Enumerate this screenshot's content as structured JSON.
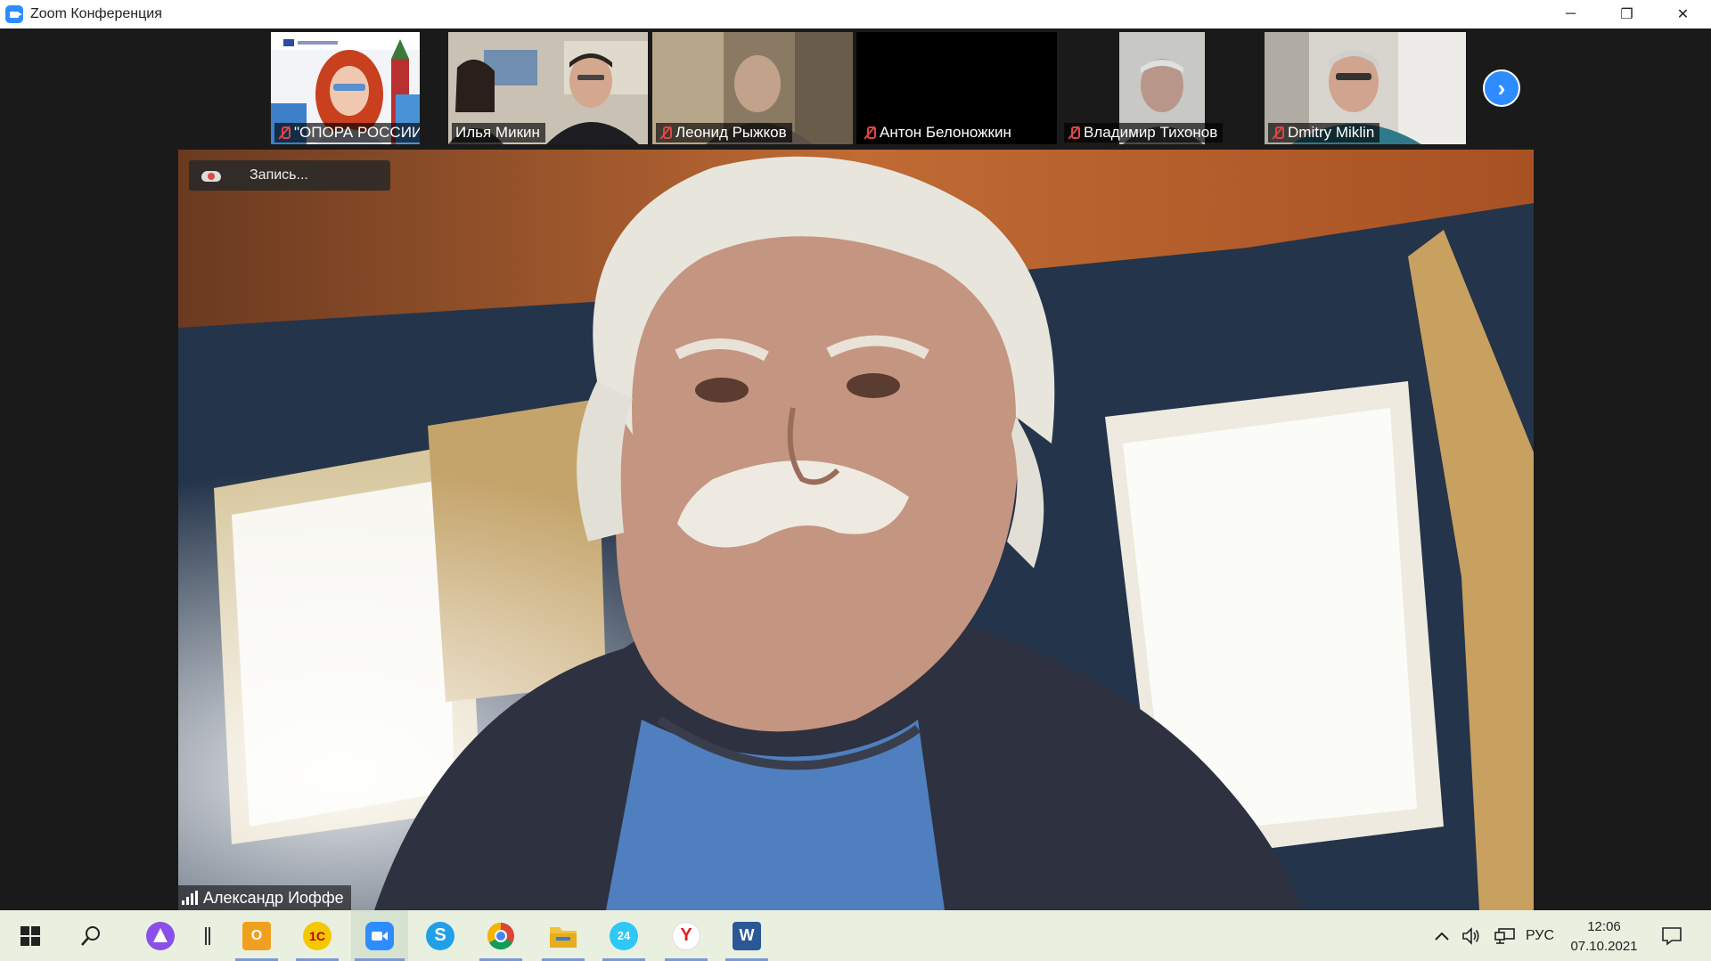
{
  "window": {
    "title": "Zoom Конференция",
    "minimize": "─",
    "restore": "❐",
    "close": "✕"
  },
  "participants": [
    {
      "name": "\"ОПОРА РОССИИ\"",
      "muted": true
    },
    {
      "name": "Илья Микин",
      "muted": false
    },
    {
      "name": "Леонид Рыжков",
      "muted": true
    },
    {
      "name": "Антон Белоножкин",
      "muted": true
    },
    {
      "name": "Владимир Тихонов",
      "muted": true
    },
    {
      "name": "Dmitry Miklin",
      "muted": true
    }
  ],
  "next_page_glyph": "›",
  "main_video": {
    "recording_label": "Запись...",
    "speaker_name": "Александр Иоффе"
  },
  "taskbar": {
    "language": "РУС",
    "time": "12:06",
    "date": "07.10.2021",
    "apps": [
      "start",
      "search",
      "alice",
      "divider",
      "outlook",
      "1c",
      "zoom",
      "skype",
      "chrome",
      "explorer",
      "bitrix24",
      "yandex",
      "word"
    ],
    "app_glyphs": {
      "outlook": "O",
      "1c": "1С",
      "skype": "S",
      "bitrix24": "24",
      "yandex": "Y",
      "word": "W"
    }
  }
}
